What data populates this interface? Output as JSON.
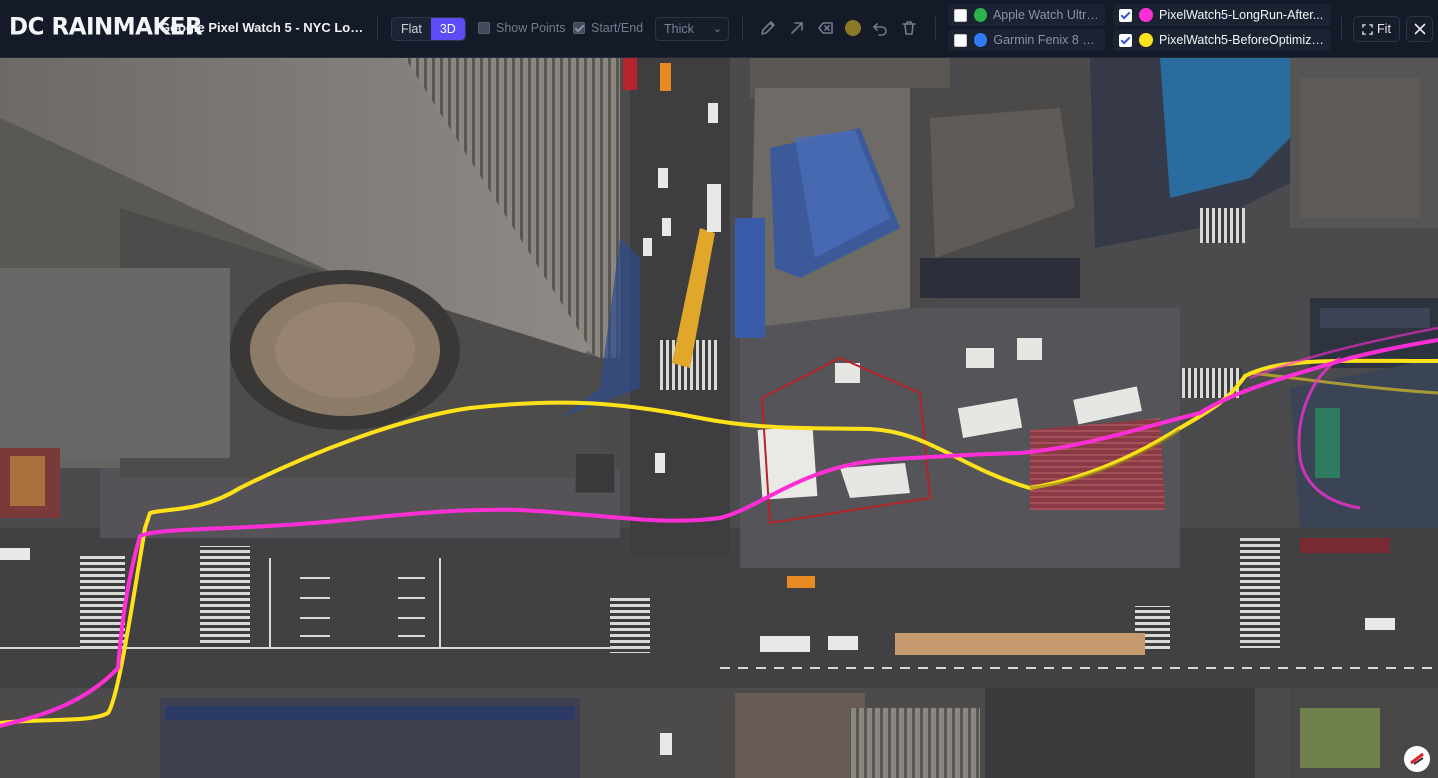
{
  "brand": "DC RAINMAKER",
  "route_title": "Google Pixel Watch 5 - NYC Long R...",
  "view_toggle": {
    "flat_label": "Flat",
    "three_d_label": "3D",
    "active": "3D"
  },
  "options": {
    "show_points": {
      "label": "Show Points",
      "checked": false
    },
    "start_end": {
      "label": "Start/End",
      "checked": true
    },
    "line_width": {
      "selected": "Thick"
    }
  },
  "tools": [
    "pencil-icon",
    "arrow-icon",
    "eraser-icon",
    "color-dot",
    "undo-icon",
    "trash-icon"
  ],
  "draw_color": "#8a7a27",
  "tracks": [
    {
      "label": "Apple Watch Ultra 3",
      "color": "#2bb24c",
      "checked": false
    },
    {
      "label": "Garmin Fenix 8 Pro",
      "color": "#2f7cf6",
      "checked": false
    },
    {
      "label": "PixelWatch5-LongRun-After...",
      "color": "#ff2fd6",
      "checked": true
    },
    {
      "label": "PixelWatch5-BeforeOptimiza...",
      "color": "#ffe21a",
      "checked": true
    }
  ],
  "fit_label": "Fit",
  "colors": {
    "accent": "#5b4cf5",
    "magenta_track": "#ff2fd6",
    "yellow_track": "#ffe21a"
  }
}
